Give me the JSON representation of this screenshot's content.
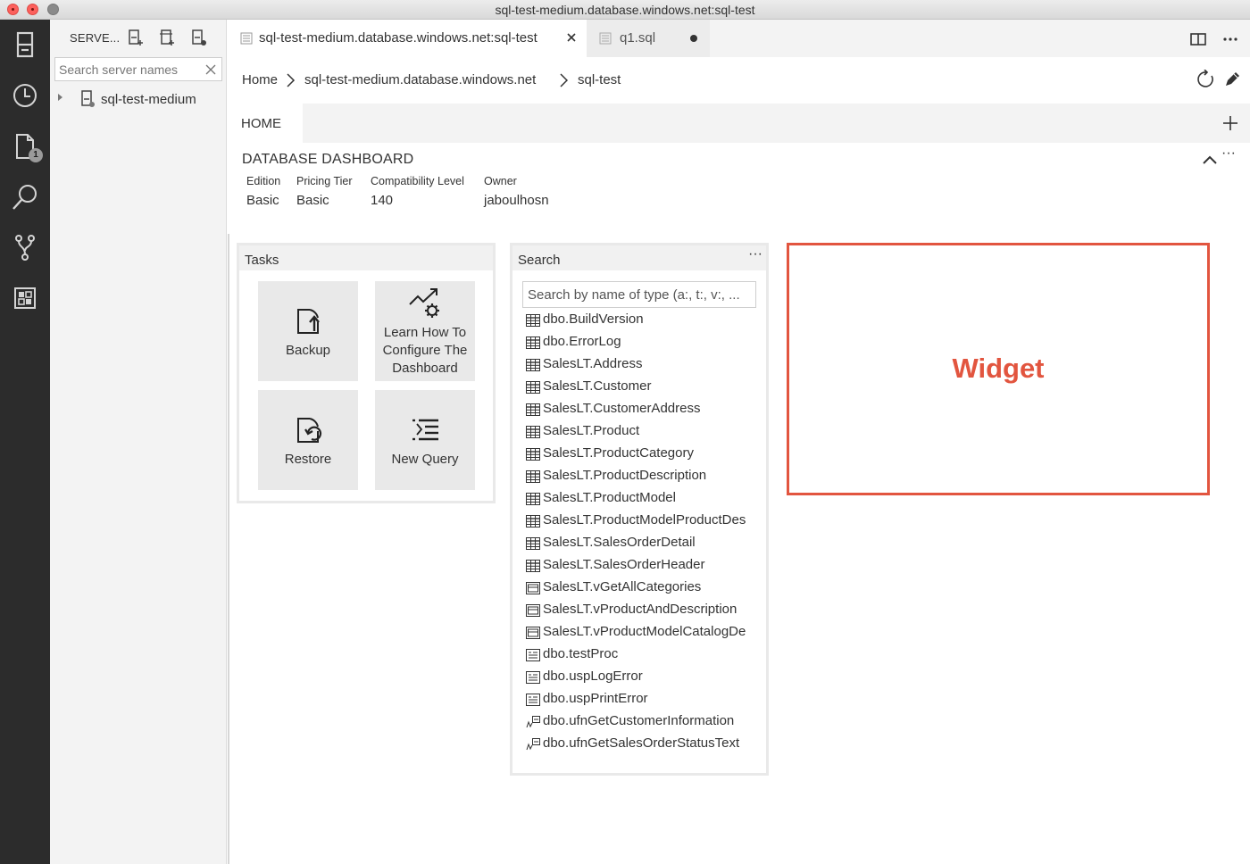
{
  "window": {
    "title": "sql-test-medium.database.windows.net:sql-test"
  },
  "activity_bar": {
    "items": [
      {
        "icon": "servers-icon"
      },
      {
        "icon": "history-icon"
      },
      {
        "icon": "explorer-icon",
        "badge": "1"
      },
      {
        "icon": "search-icon"
      },
      {
        "icon": "source-control-icon"
      },
      {
        "icon": "extensions-icon"
      }
    ]
  },
  "sidebar": {
    "title": "SERVE...",
    "search": {
      "placeholder": "Search server names",
      "value": ""
    },
    "tree": [
      {
        "label": "sql-test-medium"
      }
    ]
  },
  "tabs": [
    {
      "label": "sql-test-medium.database.windows.net:sql-test",
      "active": true
    },
    {
      "label": "q1.sql",
      "active": false,
      "dirty": true
    }
  ],
  "breadcrumb": [
    "Home",
    "sql-test-medium.database.windows.net",
    "sql-test"
  ],
  "home_tab": {
    "label": "HOME"
  },
  "dashboard": {
    "title": "DATABASE DASHBOARD",
    "properties": [
      {
        "label": "Edition",
        "value": "Basic"
      },
      {
        "label": "Pricing Tier",
        "value": "Basic"
      },
      {
        "label": "Compatibility Level",
        "value": "140"
      },
      {
        "label": "Owner",
        "value": "jaboulhosn"
      }
    ]
  },
  "tasks_widget": {
    "title": "Tasks",
    "tasks": [
      {
        "label": "Backup",
        "icon": "backup-icon"
      },
      {
        "label": "Learn How To Configure The Dashboard",
        "icon": "configure-icon"
      },
      {
        "label": "Restore",
        "icon": "restore-icon"
      },
      {
        "label": "New Query",
        "icon": "new-query-icon"
      }
    ]
  },
  "search_widget": {
    "title": "Search",
    "placeholder": "Search by name of type (a:, t:, v:, ...",
    "results": [
      {
        "name": "dbo.BuildVersion",
        "kind": "table"
      },
      {
        "name": "dbo.ErrorLog",
        "kind": "table"
      },
      {
        "name": "SalesLT.Address",
        "kind": "table"
      },
      {
        "name": "SalesLT.Customer",
        "kind": "table"
      },
      {
        "name": "SalesLT.CustomerAddress",
        "kind": "table"
      },
      {
        "name": "SalesLT.Product",
        "kind": "table"
      },
      {
        "name": "SalesLT.ProductCategory",
        "kind": "table"
      },
      {
        "name": "SalesLT.ProductDescription",
        "kind": "table"
      },
      {
        "name": "SalesLT.ProductModel",
        "kind": "table"
      },
      {
        "name": "SalesLT.ProductModelProductDes",
        "kind": "table"
      },
      {
        "name": "SalesLT.SalesOrderDetail",
        "kind": "table"
      },
      {
        "name": "SalesLT.SalesOrderHeader",
        "kind": "table"
      },
      {
        "name": "SalesLT.vGetAllCategories",
        "kind": "view"
      },
      {
        "name": "SalesLT.vProductAndDescription",
        "kind": "view"
      },
      {
        "name": "SalesLT.vProductModelCatalogDe",
        "kind": "view"
      },
      {
        "name": "dbo.testProc",
        "kind": "procedure"
      },
      {
        "name": "dbo.uspLogError",
        "kind": "procedure"
      },
      {
        "name": "dbo.uspPrintError",
        "kind": "procedure"
      },
      {
        "name": "dbo.ufnGetCustomerInformation",
        "kind": "function"
      },
      {
        "name": "dbo.ufnGetSalesOrderStatusText",
        "kind": "function"
      }
    ]
  },
  "placeholder_widget": {
    "label": "Widget",
    "color": "#e2553f"
  }
}
